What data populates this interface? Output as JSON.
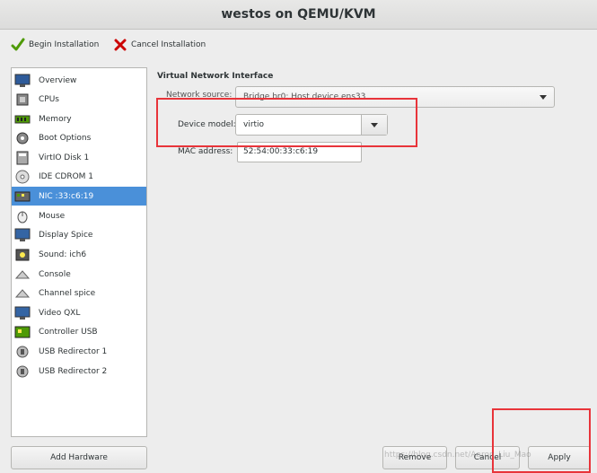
{
  "window": {
    "title": "westos on QEMU/KVM"
  },
  "toolbar": {
    "begin_label": "Begin Installation",
    "cancel_label": "Cancel Installation"
  },
  "sidebar": {
    "items": [
      {
        "label": "Overview",
        "icon": "monitor-icon"
      },
      {
        "label": "CPUs",
        "icon": "cpu-icon"
      },
      {
        "label": "Memory",
        "icon": "memory-icon"
      },
      {
        "label": "Boot Options",
        "icon": "gear-icon"
      },
      {
        "label": "VirtIO Disk 1",
        "icon": "disk-icon"
      },
      {
        "label": "IDE CDROM 1",
        "icon": "cdrom-icon"
      },
      {
        "label": "NIC :33:c6:19",
        "icon": "network-icon"
      },
      {
        "label": "Mouse",
        "icon": "mouse-icon"
      },
      {
        "label": "Display Spice",
        "icon": "display-icon"
      },
      {
        "label": "Sound: ich6",
        "icon": "sound-icon"
      },
      {
        "label": "Console",
        "icon": "console-icon"
      },
      {
        "label": "Channel spice",
        "icon": "channel-icon"
      },
      {
        "label": "Video QXL",
        "icon": "video-icon"
      },
      {
        "label": "Controller USB",
        "icon": "controller-icon"
      },
      {
        "label": "USB Redirector 1",
        "icon": "usb-icon"
      },
      {
        "label": "USB Redirector 2",
        "icon": "usb-icon"
      }
    ],
    "selected_index": 6,
    "add_hardware_label": "Add Hardware"
  },
  "details": {
    "section_title": "Virtual Network Interface",
    "network_source_label": "Network source:",
    "network_source_value": "Bridge br0: Host device ens33",
    "device_model_label": "Device model:",
    "device_model_value": "virtio",
    "mac_label": "MAC address:",
    "mac_value": "52:54:00:33:c6:19"
  },
  "buttons": {
    "remove_label": "Remove",
    "cancel_label": "Cancel",
    "apply_label": "Apply"
  },
  "watermark": "https://blog.csdn.net/Aaron_Liu_Mao",
  "colors": {
    "selection": "#4a90d9",
    "highlight_box": "#e8343a"
  }
}
